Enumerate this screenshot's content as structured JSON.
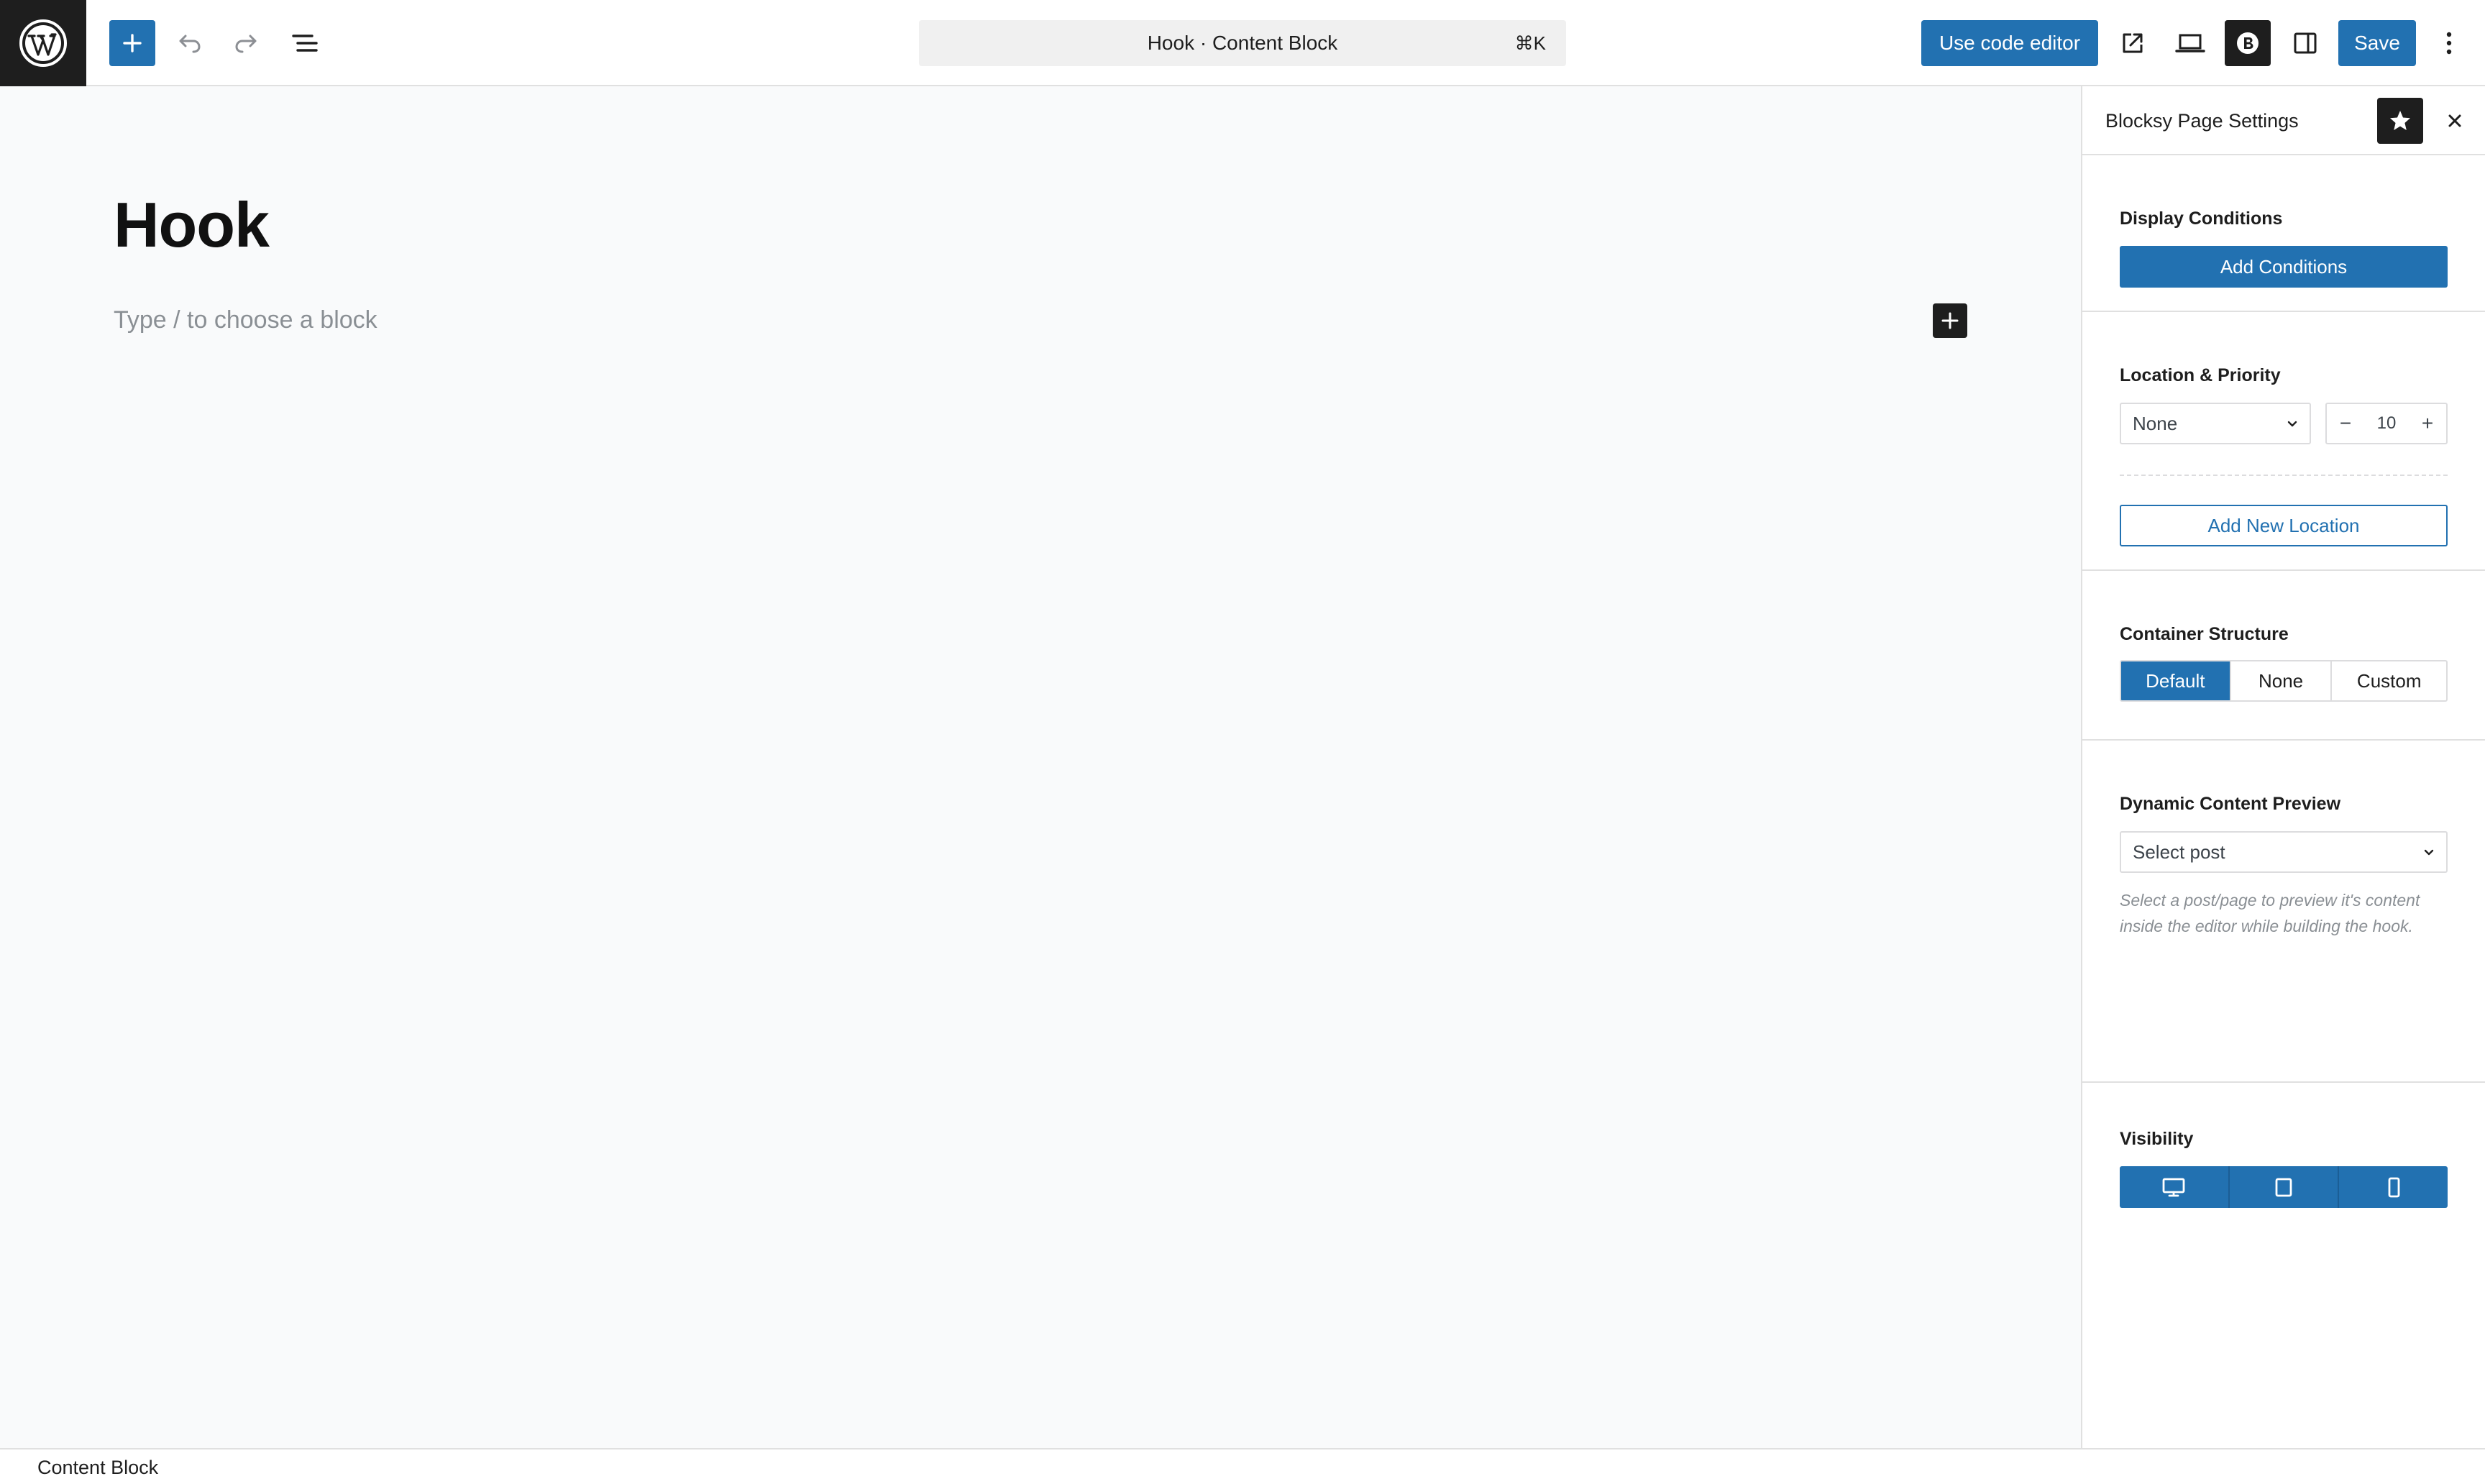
{
  "header": {
    "command_center_label": "Hook · Content Block",
    "command_center_shortcut": "⌘K",
    "code_editor_label": "Use code editor",
    "save_label": "Save"
  },
  "editor": {
    "title": "Hook",
    "block_placeholder": "Type / to choose a block"
  },
  "sidebar": {
    "title": "Blocksy Page Settings",
    "display_conditions": {
      "label": "Display Conditions",
      "button": "Add Conditions"
    },
    "location_priority": {
      "label": "Location & Priority",
      "location_value": "None",
      "priority_value": "10",
      "minus": "−",
      "plus": "+",
      "add_location": "Add New Location"
    },
    "container_structure": {
      "label": "Container Structure",
      "options": [
        "Default",
        "None",
        "Custom"
      ],
      "selected": "Default"
    },
    "dynamic_preview": {
      "label": "Dynamic Content Preview",
      "select_value": "Select post",
      "help": "Select a post/page to preview it's content inside the editor while building the hook."
    },
    "visibility": {
      "label": "Visibility",
      "devices": [
        "desktop-icon",
        "tablet-icon",
        "mobile-icon"
      ]
    }
  },
  "footer": {
    "breadcrumb": "Content Block"
  },
  "colors": {
    "accent": "#2271b1",
    "dark": "#1e1e1e",
    "canvas_bg": "#f9fafb"
  }
}
